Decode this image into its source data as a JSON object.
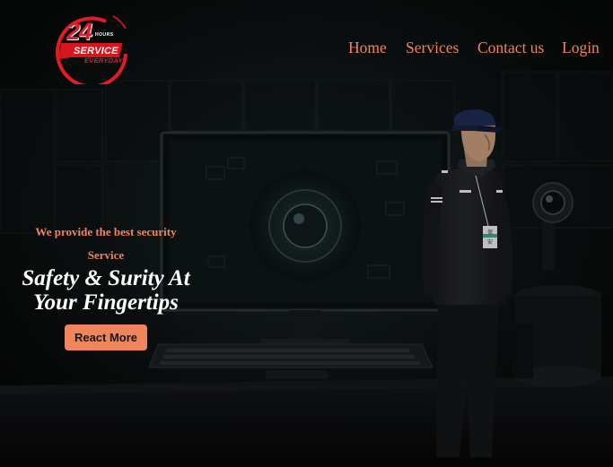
{
  "logo": {
    "big_text": "24",
    "hours_text": "HOURS",
    "service_text": "SERVICE",
    "everyday_text": "EVERYDAY",
    "ring_color": "#e31b23"
  },
  "nav": {
    "items": [
      {
        "label": "Home"
      },
      {
        "label": "Services"
      },
      {
        "label": "Contact us"
      },
      {
        "label": "Login"
      }
    ],
    "text_color": "#f0845a"
  },
  "hero": {
    "tagline": "We provide the best security Service",
    "headline_line1": "Safety & Surity At",
    "headline_line2": "Your Fingertips",
    "cta_label": "React More",
    "badge_text": "保 安"
  },
  "colors": {
    "accent": "#f0845a",
    "background": "#0a0a0b",
    "headline": "#ffffff",
    "brand_red": "#e31b23"
  }
}
